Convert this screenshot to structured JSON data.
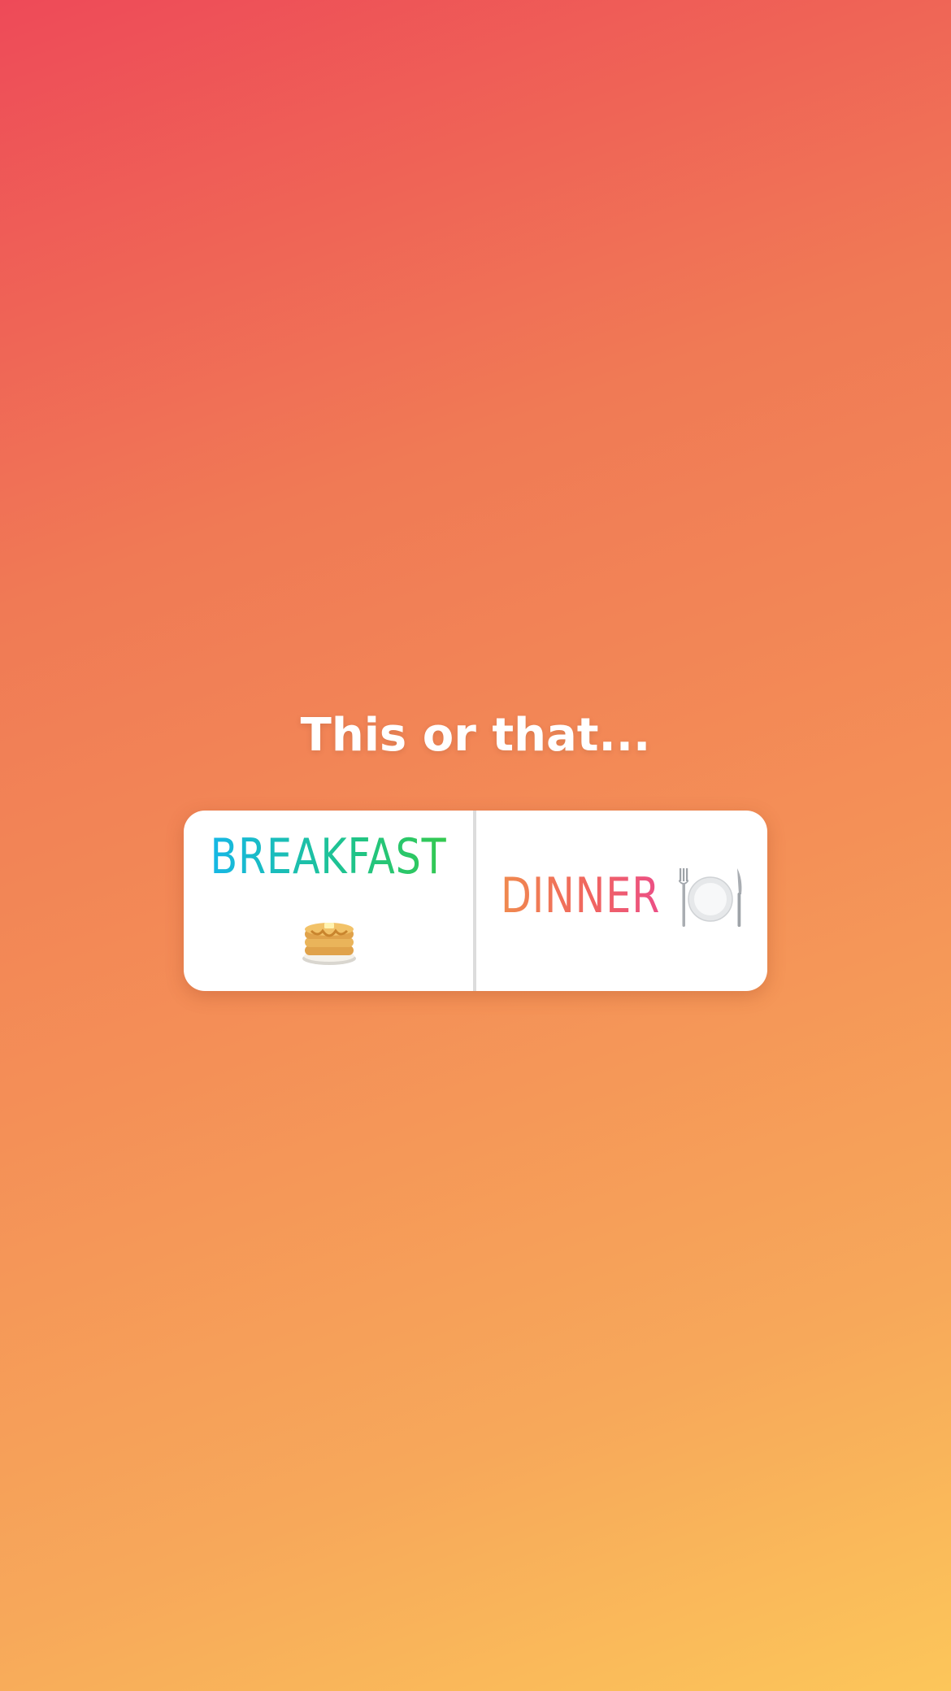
{
  "question": "This or that...",
  "options": [
    {
      "label": "BREAKFAST",
      "icon": "pancakes-icon"
    },
    {
      "label": "DINNER",
      "icon": "fork-knife-plate-icon"
    }
  ],
  "colors": {
    "breakfast_gradient": [
      "#16b7e6",
      "#34c94f"
    ],
    "dinner_gradient": [
      "#f08a4e",
      "#ec4f86"
    ],
    "background_gradient": [
      "#ee4a58",
      "#fcc65a"
    ]
  }
}
